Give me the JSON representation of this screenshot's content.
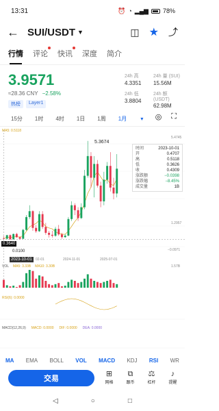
{
  "status": {
    "time": "13:31",
    "battery": "78%"
  },
  "header": {
    "pair": "SUI/USDT"
  },
  "tabs": [
    "行情",
    "评论",
    "快讯",
    "深度",
    "简介"
  ],
  "price": {
    "last": "3.9571",
    "cny": "≈28.36 CNY",
    "change": "−2.58%"
  },
  "tags": [
    "热榜",
    "Layer1"
  ],
  "stats": {
    "high_label": "24h 高",
    "high": "4.3351",
    "vol_label": "24h 量 (SUI)",
    "vol": "15.56M",
    "low_label": "24h 低",
    "low": "3.8804",
    "amt_label": "24h 额 (USDT)",
    "amt": "62.98M"
  },
  "intervals": [
    "15分",
    "1时",
    "4时",
    "1日",
    "1周",
    "1月"
  ],
  "intervals_selected": "1月",
  "ma_legend": "MA5: 0.5118",
  "axis": {
    "y_top": "5.4745",
    "y_mid": "1.2957",
    "y_neg": "−0.0971",
    "x1": "02-01",
    "x2": "2024-11-01",
    "x3": "2025-07-01"
  },
  "low_flag": "0.3640",
  "low_value": "0.0100",
  "high_value": "5.3674",
  "date_flag": "2023-10-01",
  "tooltip": [
    {
      "k": "时间",
      "v": "2023-10-01"
    },
    {
      "k": "开",
      "v": "0.4707"
    },
    {
      "k": "高",
      "v": "0.5118"
    },
    {
      "k": "低",
      "v": "0.3626"
    },
    {
      "k": "收",
      "v": "0.4309"
    },
    {
      "k": "涨跌额",
      "v": "−0.0398"
    },
    {
      "k": "涨跌幅",
      "v": "−8.45%"
    },
    {
      "k": "成交量",
      "v": "1B"
    }
  ],
  "vol_legend": {
    "vol": "VOL",
    "ma": "MA5: 3.33B",
    "ma10": "MA10: 3.30B",
    "right": "1.57B"
  },
  "rsi_legend": "RSI(6): 0.0000",
  "macd_legend": {
    "macd": "MACD(12,26,9)",
    "m": "MACD: 0.0000",
    "dif": "DIF: 0.0000",
    "dea": "DEA: 0.0000"
  },
  "indicators": [
    "MA",
    "EMA",
    "BOLL",
    "VOL",
    "MACD",
    "KDJ",
    "RSI",
    "WR"
  ],
  "indicators_active": [
    "MA",
    "VOL",
    "MACD",
    "RSI"
  ],
  "trade_label": "交易",
  "actions": [
    {
      "label": "网格",
      "icon": "grid-bot-icon"
    },
    {
      "label": "跟币",
      "icon": "copy-icon"
    },
    {
      "label": "杠杆",
      "icon": "leverage-icon"
    },
    {
      "label": "提醒",
      "icon": "bell-icon"
    }
  ],
  "colors": {
    "up": "#1aa35f",
    "down": "#e53950",
    "accent": "#1565e8"
  },
  "candles": [
    [
      0.42,
      0.55,
      0.38,
      0.4
    ],
    [
      0.4,
      0.6,
      0.36,
      0.58
    ],
    [
      0.58,
      0.62,
      0.35,
      0.37
    ],
    [
      0.37,
      0.66,
      0.36,
      0.64
    ],
    [
      0.64,
      0.7,
      0.45,
      0.48
    ],
    [
      0.48,
      0.5,
      0.36,
      0.4
    ],
    [
      0.4,
      0.9,
      0.38,
      0.85
    ],
    [
      0.85,
      1.6,
      0.8,
      1.5
    ],
    [
      1.5,
      2.1,
      1.4,
      1.8
    ],
    [
      1.8,
      1.85,
      0.8,
      0.95
    ],
    [
      0.95,
      1.1,
      0.7,
      0.78
    ],
    [
      0.78,
      1.8,
      0.75,
      1.65
    ],
    [
      1.65,
      1.8,
      0.9,
      1.0
    ],
    [
      1.0,
      1.2,
      0.6,
      0.7
    ],
    [
      0.7,
      0.8,
      0.46,
      0.6
    ],
    [
      0.6,
      0.8,
      0.46,
      0.55
    ],
    [
      0.55,
      1.0,
      0.5,
      0.9
    ],
    [
      0.9,
      1.1,
      0.55,
      0.62
    ],
    [
      0.62,
      0.7,
      0.4,
      0.48
    ],
    [
      0.48,
      0.64,
      0.45,
      0.56
    ],
    [
      0.56,
      1.5,
      0.52,
      1.4
    ],
    [
      1.4,
      2.3,
      1.3,
      2.1
    ],
    [
      2.1,
      2.2,
      1.6,
      1.85
    ],
    [
      1.85,
      2.0,
      1.3,
      1.45
    ],
    [
      1.45,
      2.2,
      1.4,
      2.0
    ],
    [
      2.0,
      3.9,
      1.9,
      3.6
    ],
    [
      3.6,
      5.37,
      3.5,
      4.6
    ],
    [
      4.6,
      4.8,
      3.0,
      3.5
    ],
    [
      3.5,
      4.6,
      2.5,
      4.2
    ],
    [
      4.2,
      4.4,
      3.0,
      3.1
    ],
    [
      3.1,
      3.3,
      2.0,
      2.3
    ],
    [
      2.3,
      3.8,
      2.1,
      3.4
    ],
    [
      3.4,
      4.3,
      3.2,
      4.1
    ],
    [
      4.1,
      4.8,
      2.8,
      3.0
    ],
    [
      3.0,
      3.5,
      2.4,
      2.7
    ],
    [
      2.7,
      4.7,
      2.5,
      3.96
    ]
  ],
  "volumes": [
    0.55,
    0.3,
    0.25,
    0.28,
    0.22,
    0.3,
    0.45,
    0.85,
    1.0,
    0.95,
    0.6,
    0.75,
    0.7,
    0.5,
    0.35,
    0.3,
    0.35,
    0.4,
    0.25,
    0.28,
    0.45,
    0.55,
    0.5,
    0.4,
    0.45,
    0.6,
    0.8,
    0.6,
    0.5,
    0.45,
    0.4,
    0.45,
    0.5,
    0.55,
    0.4,
    0.35
  ]
}
